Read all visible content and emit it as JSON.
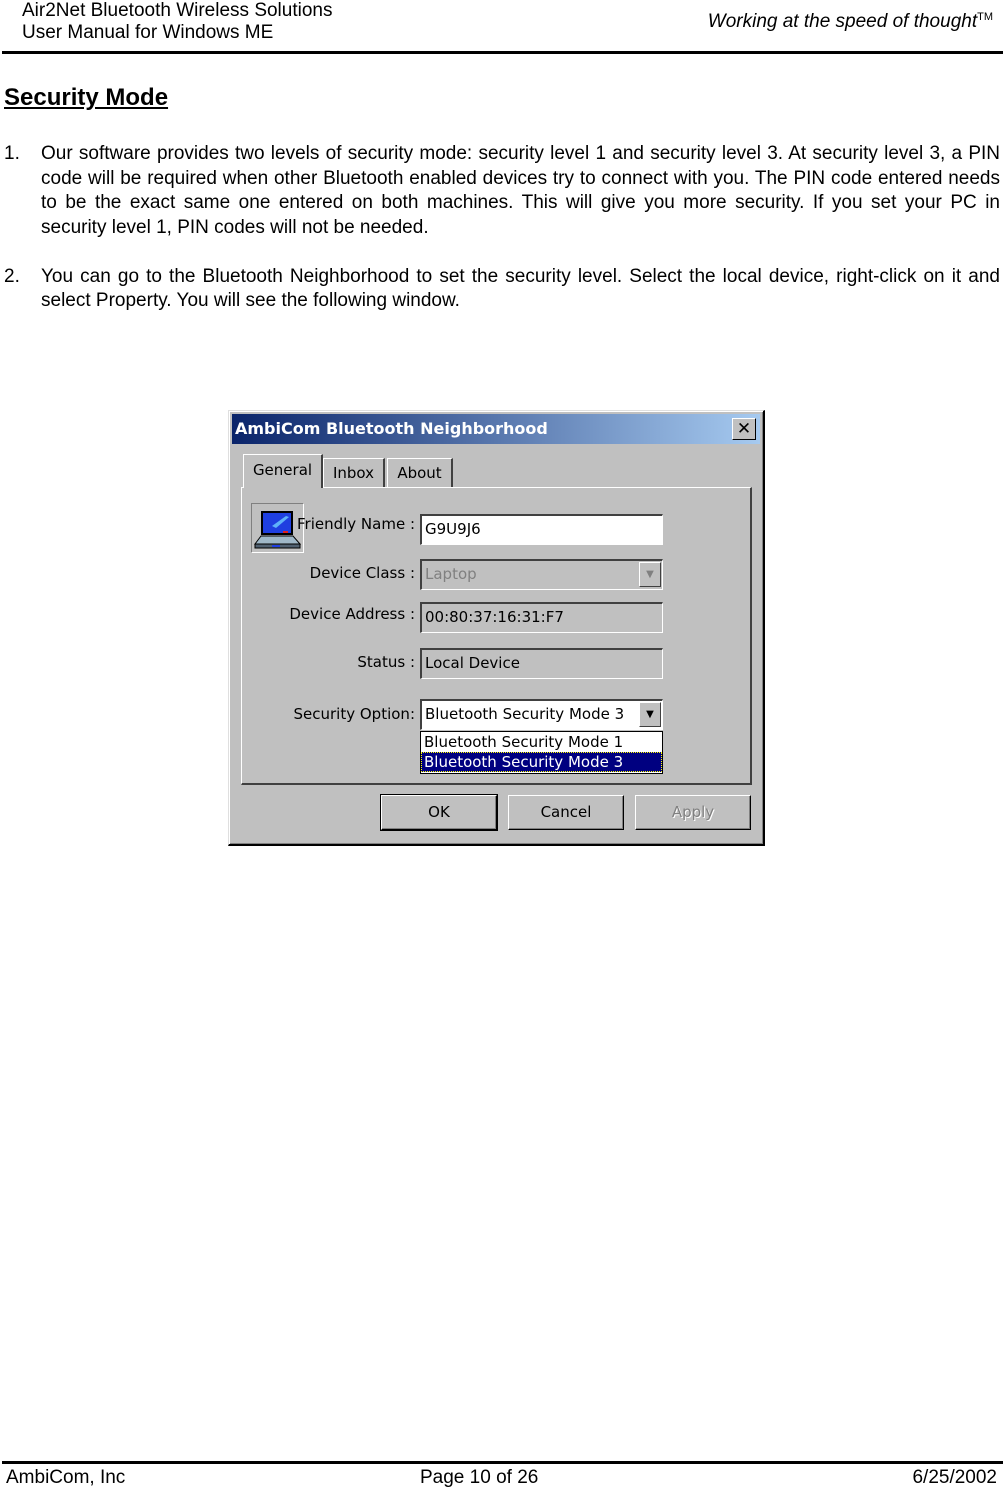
{
  "header": {
    "line1": "Air2Net Bluetooth Wireless Solutions",
    "line2": "User Manual for Windows ME",
    "tagline": "Working at the speed of thought",
    "tagline_mark": "TM"
  },
  "section_title": "Security Mode",
  "steps": [
    {
      "number": "1.",
      "text": "Our software provides two levels of security mode: security level 1 and security level 3. At security level 3, a PIN code will be required when other Bluetooth enabled devices try to connect with you.  The PIN code entered needs to be the exact same one entered on both machines. This will give you more security. If you set your PC in security level 1, PIN codes will not be needed."
    },
    {
      "number": "2.",
      "text": "You can go to the Bluetooth Neighborhood to set the security level. Select the local device, right-click on it and select Property.  You will see the following window."
    }
  ],
  "dialog": {
    "title": "AmbiCom Bluetooth Neighborhood",
    "close_glyph": "✕",
    "tabs": [
      {
        "label": "General",
        "active": true
      },
      {
        "label": "Inbox",
        "active": false
      },
      {
        "label": "About",
        "active": false
      }
    ],
    "fields": {
      "friendly_name": {
        "label": "Friendly Name :",
        "value": "G9U9J6"
      },
      "device_class": {
        "label": "Device Class :",
        "value": "Laptop"
      },
      "device_address": {
        "label": "Device Address :",
        "value": "00:80:37:16:31:F7"
      },
      "status": {
        "label": "Status :",
        "value": "Local Device"
      },
      "security_option": {
        "label": "Security Option:",
        "value": "Bluetooth Security Mode 3"
      }
    },
    "security_options": [
      {
        "label": "Bluetooth Security Mode 1",
        "selected": false
      },
      {
        "label": "Bluetooth Security Mode 3",
        "selected": true
      }
    ],
    "dropdown_glyph": "▼",
    "buttons": {
      "ok": "OK",
      "cancel": "Cancel",
      "apply": "Apply"
    },
    "colors": {
      "titlebar_start": "#0a246a",
      "titlebar_end": "#a6caf0",
      "selection": "#000080"
    }
  },
  "footer": {
    "company": "AmbiCom, Inc",
    "page": "Page 10 of 26",
    "date": "6/25/2002"
  }
}
